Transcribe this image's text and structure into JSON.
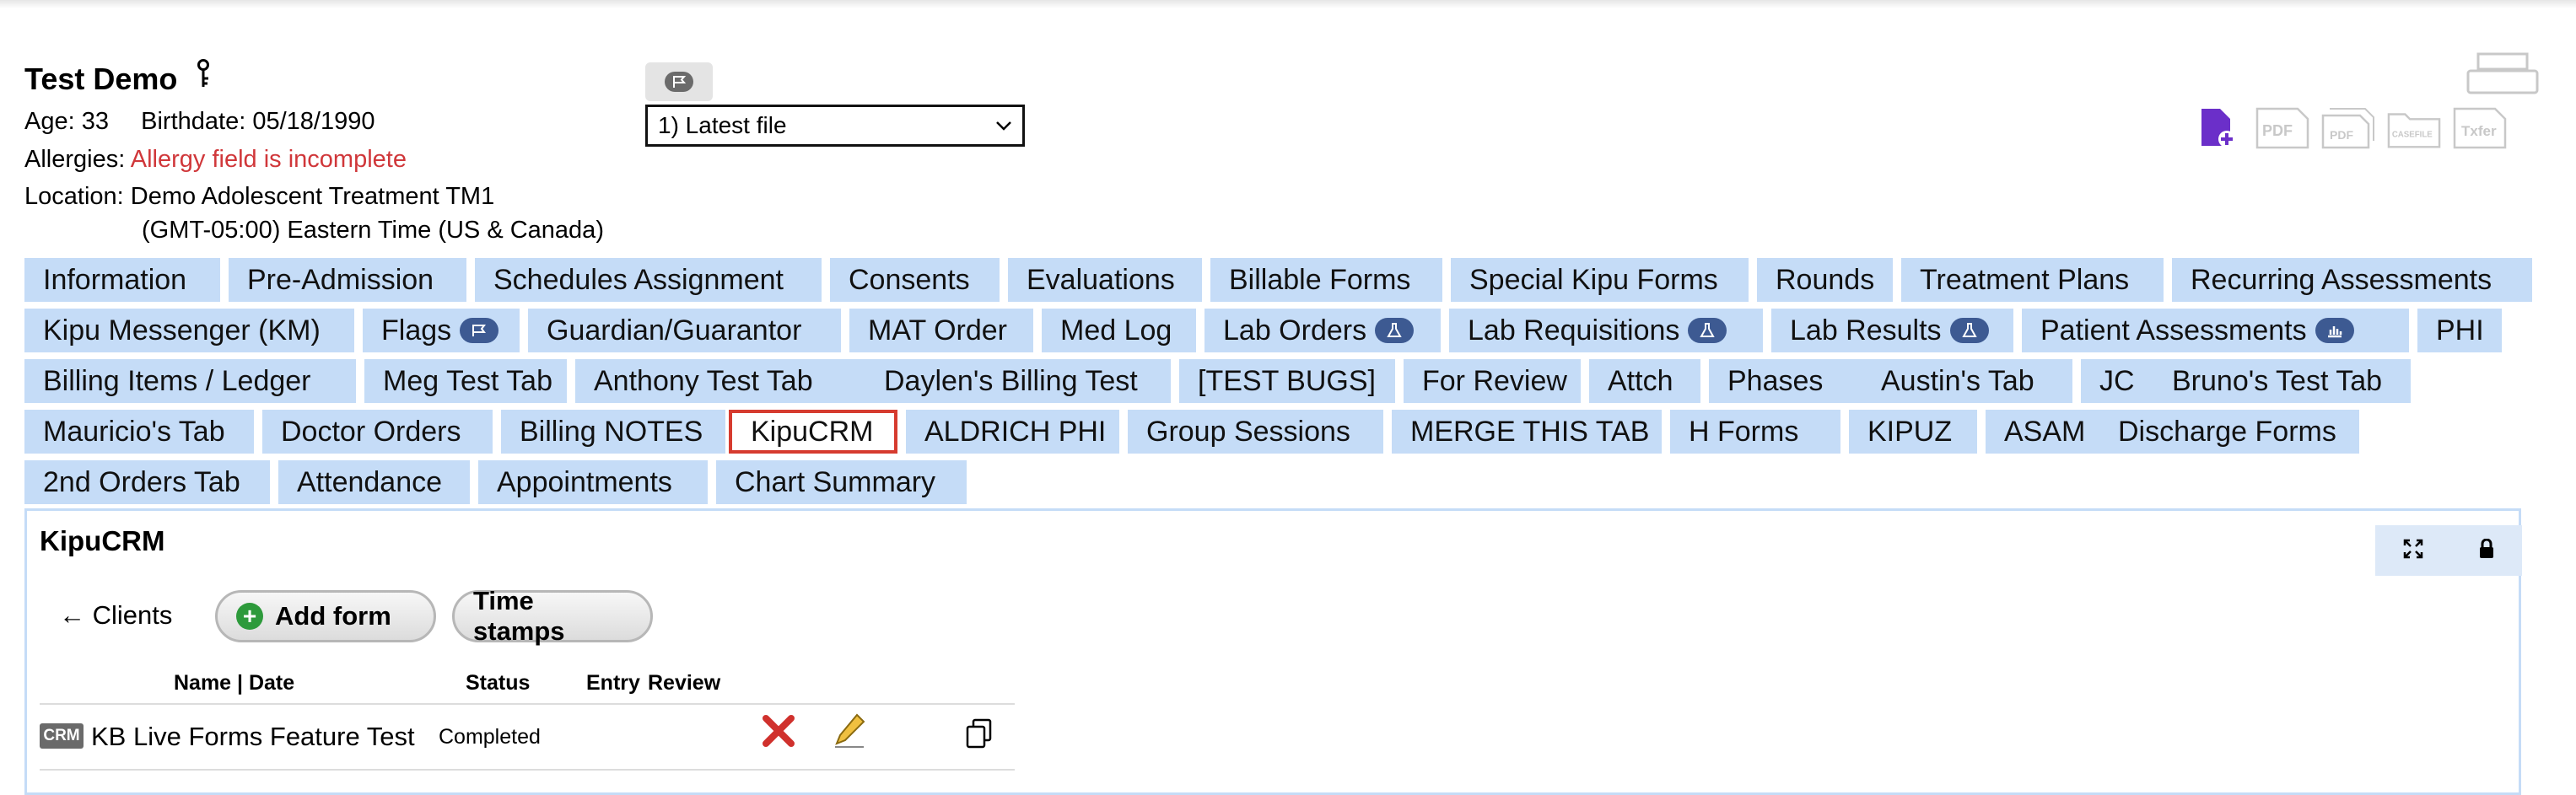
{
  "patient": {
    "name": "Test Demo",
    "age_label": "Age:",
    "age": "33",
    "birthdate_label": "Birthdate:",
    "birthdate": "05/18/1990",
    "allergies_label": "Allergies:",
    "allergies": "Allergy field is incomplete",
    "location_label": "Location:",
    "location": "Demo Adolescent Treatment TM1",
    "timezone": "(GMT-05:00) Eastern Time (US & Canada)"
  },
  "file_select": {
    "value": "1) Latest file"
  },
  "icons": {
    "key": "key-icon",
    "flag": "flag-icon",
    "printer": "printer-icon",
    "new_doc": "add-document-icon",
    "pdf": "pdf-icon",
    "multi_pdf": "multi-pdf-icon",
    "casefile": "casefile-icon",
    "txfer": "txfer-icon",
    "lab": "flask-icon",
    "chart": "bar-chart-icon",
    "expand": "expand-icon",
    "lock": "lock-icon",
    "delete": "delete-x-icon",
    "edit": "pencil-icon",
    "copy": "copy-icon"
  },
  "doc_tools": {
    "pdf": "PDF",
    "multi_pdf": "PDF",
    "casefile": "CASEFILE",
    "txfer": "Txfer"
  },
  "tabs": {
    "row1": [
      "Information",
      "Pre-Admission",
      "Schedules Assignment",
      "Consents",
      "Evaluations",
      "Billable Forms",
      "Special Kipu Forms",
      "Rounds",
      "Treatment Plans",
      "Recurring Assessments"
    ],
    "row2": [
      "Kipu Messenger (KM)",
      "Flags",
      "Guardian/Guarantor",
      "MAT Order",
      "Med Log",
      "Lab Orders",
      "Lab Requisitions",
      "Lab Results",
      "Patient Assessments",
      "PHI"
    ],
    "row3": [
      "Billing Items / Ledger",
      "Meg Test Tab",
      "Anthony Test Tab",
      "Daylen's Billing Test",
      "[TEST BUGS]",
      "For Review",
      "Attch",
      "Phases",
      "Austin's Tab",
      "JC",
      "Bruno's Test Tab"
    ],
    "row4": [
      "Mauricio's Tab",
      "Doctor Orders",
      "Billing NOTES",
      "KipuCRM",
      "ALDRICH PHI",
      "Group Sessions",
      "MERGE THIS TAB",
      "H Forms",
      "KIPUZ",
      "ASAM",
      "Discharge Forms"
    ],
    "row5": [
      "2nd Orders Tab",
      "Attendance",
      "Appointments",
      "Chart Summary"
    ],
    "selected": "KipuCRM"
  },
  "panel": {
    "title": "KipuCRM",
    "back_label": "← Clients",
    "add_form_label": "Add form",
    "time_stamps_label": "Time stamps",
    "columns": [
      "Name | Date",
      "Status",
      "Entry",
      "Review"
    ],
    "rows": [
      {
        "badge": "CRM",
        "name": "KB Live Forms Feature Test",
        "status": "Completed"
      }
    ]
  },
  "colors": {
    "tab_bg": "#c5dcf7",
    "selected_border": "#d63b2f",
    "warning": "#d0373a",
    "badge": "#3d5a92",
    "add_icon": "#2d9a3b"
  }
}
